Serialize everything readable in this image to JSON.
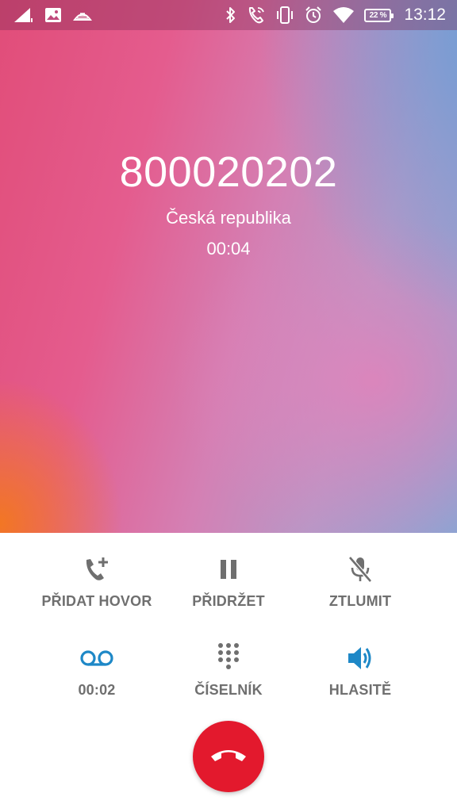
{
  "status_bar": {
    "time": "13:12",
    "battery_percent": "22 %",
    "icons_left": [
      "signal-icon",
      "image-notification-icon",
      "lock-screen-icon"
    ],
    "icons_right": [
      "bluetooth-icon",
      "wifi-calling-icon",
      "vibrate-icon",
      "alarm-icon",
      "wifi-icon",
      "battery-icon"
    ]
  },
  "call": {
    "number": "800020202",
    "location": "Česká republika",
    "duration": "00:04"
  },
  "controls": {
    "add_call": {
      "label": "PŘIDAT HOVOR",
      "icon": "add-call-icon"
    },
    "hold": {
      "label": "PŘIDRŽET",
      "icon": "pause-icon"
    },
    "mute": {
      "label": "ZTLUMIT",
      "icon": "mic-off-icon"
    },
    "voicemail": {
      "label": "00:02",
      "icon": "voicemail-icon"
    },
    "dialpad": {
      "label": "ČÍSELNÍK",
      "icon": "dialpad-icon"
    },
    "speaker": {
      "label": "HLASITĚ",
      "icon": "speaker-icon"
    },
    "end_call": {
      "icon": "end-call-icon"
    }
  },
  "colors": {
    "accent_blue": "#1e88c7",
    "end_call_red": "#e3192d",
    "label_gray": "#6f6f6f"
  }
}
